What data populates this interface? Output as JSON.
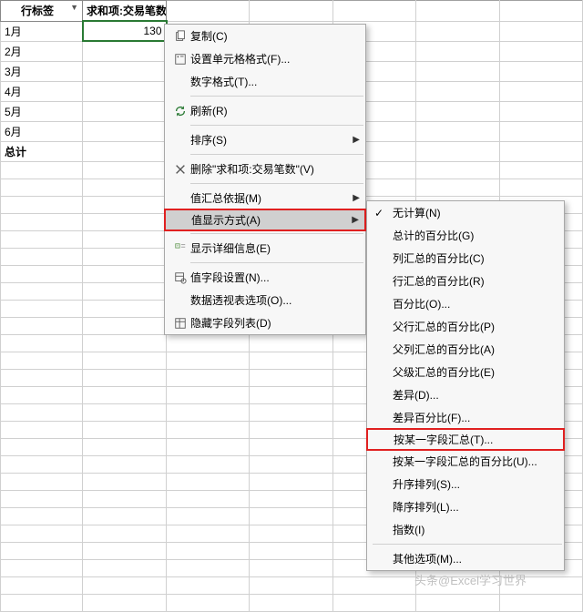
{
  "table": {
    "headers": {
      "colA": "行标签",
      "colB": "求和项:交易笔数"
    },
    "rows": [
      "1月",
      "2月",
      "3月",
      "4月",
      "5月",
      "6月"
    ],
    "total_label": "总计",
    "active_value": "130"
  },
  "menu": {
    "copy": "复制(C)",
    "format_cells": "设置单元格格式(F)...",
    "number_format": "数字格式(T)...",
    "refresh": "刷新(R)",
    "sort": "排序(S)",
    "remove_field": "删除\"求和项:交易笔数\"(V)",
    "summarize_by": "值汇总依据(M)",
    "show_values_as": "值显示方式(A)",
    "show_details": "显示详细信息(E)",
    "field_settings": "值字段设置(N)...",
    "pivot_options": "数据透视表选项(O)...",
    "hide_field_list": "隐藏字段列表(D)"
  },
  "submenu": {
    "no_calc": "无计算(N)",
    "pct_grand": "总计的百分比(G)",
    "pct_col": "列汇总的百分比(C)",
    "pct_row": "行汇总的百分比(R)",
    "pct_of": "百分比(O)...",
    "pct_parent_row": "父行汇总的百分比(P)",
    "pct_parent_col": "父列汇总的百分比(A)",
    "pct_parent": "父级汇总的百分比(E)",
    "diff": "差异(D)...",
    "pct_diff": "差异百分比(F)...",
    "running_total": "按某一字段汇总(T)...",
    "pct_running": "按某一字段汇总的百分比(U)...",
    "rank_asc": "升序排列(S)...",
    "rank_desc": "降序排列(L)...",
    "index": "指数(I)",
    "more": "其他选项(M)..."
  },
  "watermark": "头条@Excel学习世界"
}
